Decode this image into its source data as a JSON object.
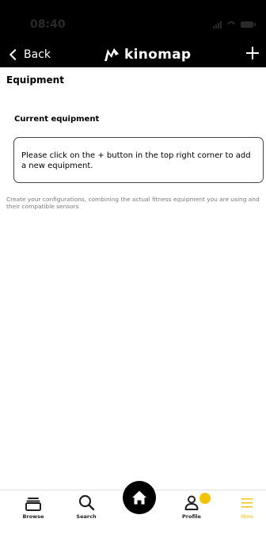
{
  "status_bar": {
    "time": "08:40"
  },
  "nav": {
    "back_label": "Back",
    "brand_name": "kinomap",
    "add_label": "+"
  },
  "page": {
    "title": "Equipment",
    "section_title": "Current equipment",
    "info_text": "Please click on the + button in the top right corner to add a new equipment.",
    "hint_text": "Create your configurations, combining the actual fitness equipment you are using and their compatible sensors"
  },
  "tabs": [
    {
      "label": "Browse",
      "icon": "browse-icon"
    },
    {
      "label": "Search",
      "icon": "search-icon"
    },
    {
      "label": "",
      "icon": "home-icon"
    },
    {
      "label": "Profile",
      "icon": "profile-icon"
    },
    {
      "label": "More",
      "icon": "menu-icon"
    }
  ],
  "colors": {
    "accent": "#f5c400",
    "bar_background": "#000000",
    "hint_text": "#7b7b7b"
  }
}
